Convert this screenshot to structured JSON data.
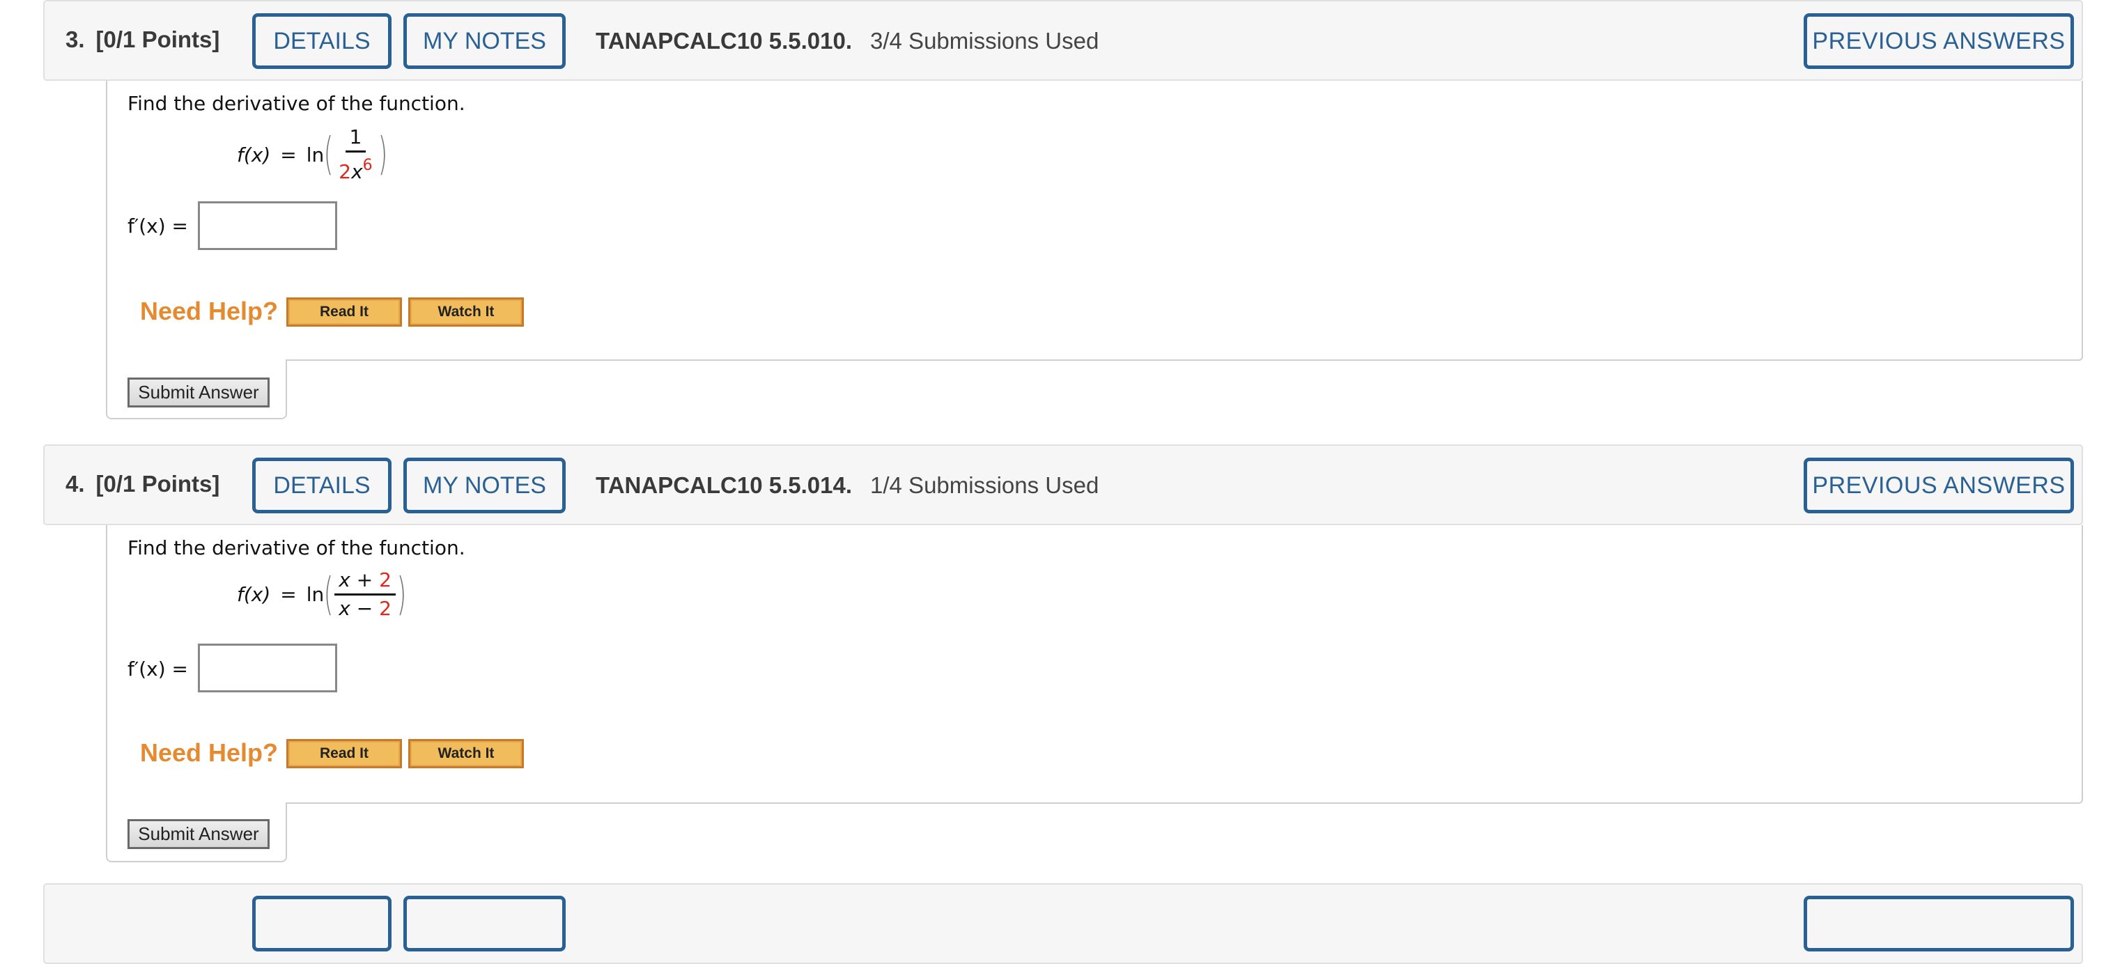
{
  "questions": [
    {
      "number": "3.",
      "points": "[0/1 Points]",
      "details_label": "DETAILS",
      "notes_label": "MY NOTES",
      "code": "TANAPCALC10 5.5.010.",
      "submissions": "3/4 Submissions Used",
      "previous_label": "PREVIOUS ANSWERS",
      "prompt": "Find the derivative of the function.",
      "formula": {
        "lhs": "f(x)",
        "equals": "=",
        "func": "ln",
        "num": "1",
        "den_coef": "2",
        "den_var": "x",
        "den_exp": "6"
      },
      "answer_label": "f′(x) =",
      "answer_value": "",
      "need_help": "Need Help?",
      "read_it": "Read It",
      "watch_it": "Watch It",
      "submit": "Submit Answer"
    },
    {
      "number": "4.",
      "points": "[0/1 Points]",
      "details_label": "DETAILS",
      "notes_label": "MY NOTES",
      "code": "TANAPCALC10 5.5.014.",
      "submissions": "1/4 Submissions Used",
      "previous_label": "PREVIOUS ANSWERS",
      "prompt": "Find the derivative of the function.",
      "formula": {
        "lhs": "f(x)",
        "equals": "=",
        "func": "ln",
        "num_var": "x",
        "num_op": "+",
        "num_const": "2",
        "den_var": "x",
        "den_op": "−",
        "den_const": "2"
      },
      "answer_label": "f′(x) =",
      "answer_value": "",
      "need_help": "Need Help?",
      "read_it": "Read It",
      "watch_it": "Watch It",
      "submit": "Submit Answer"
    }
  ],
  "colors": {
    "accent_blue": "#2a6194",
    "help_orange": "#e58a2e",
    "highlight_red": "#e0271e"
  }
}
